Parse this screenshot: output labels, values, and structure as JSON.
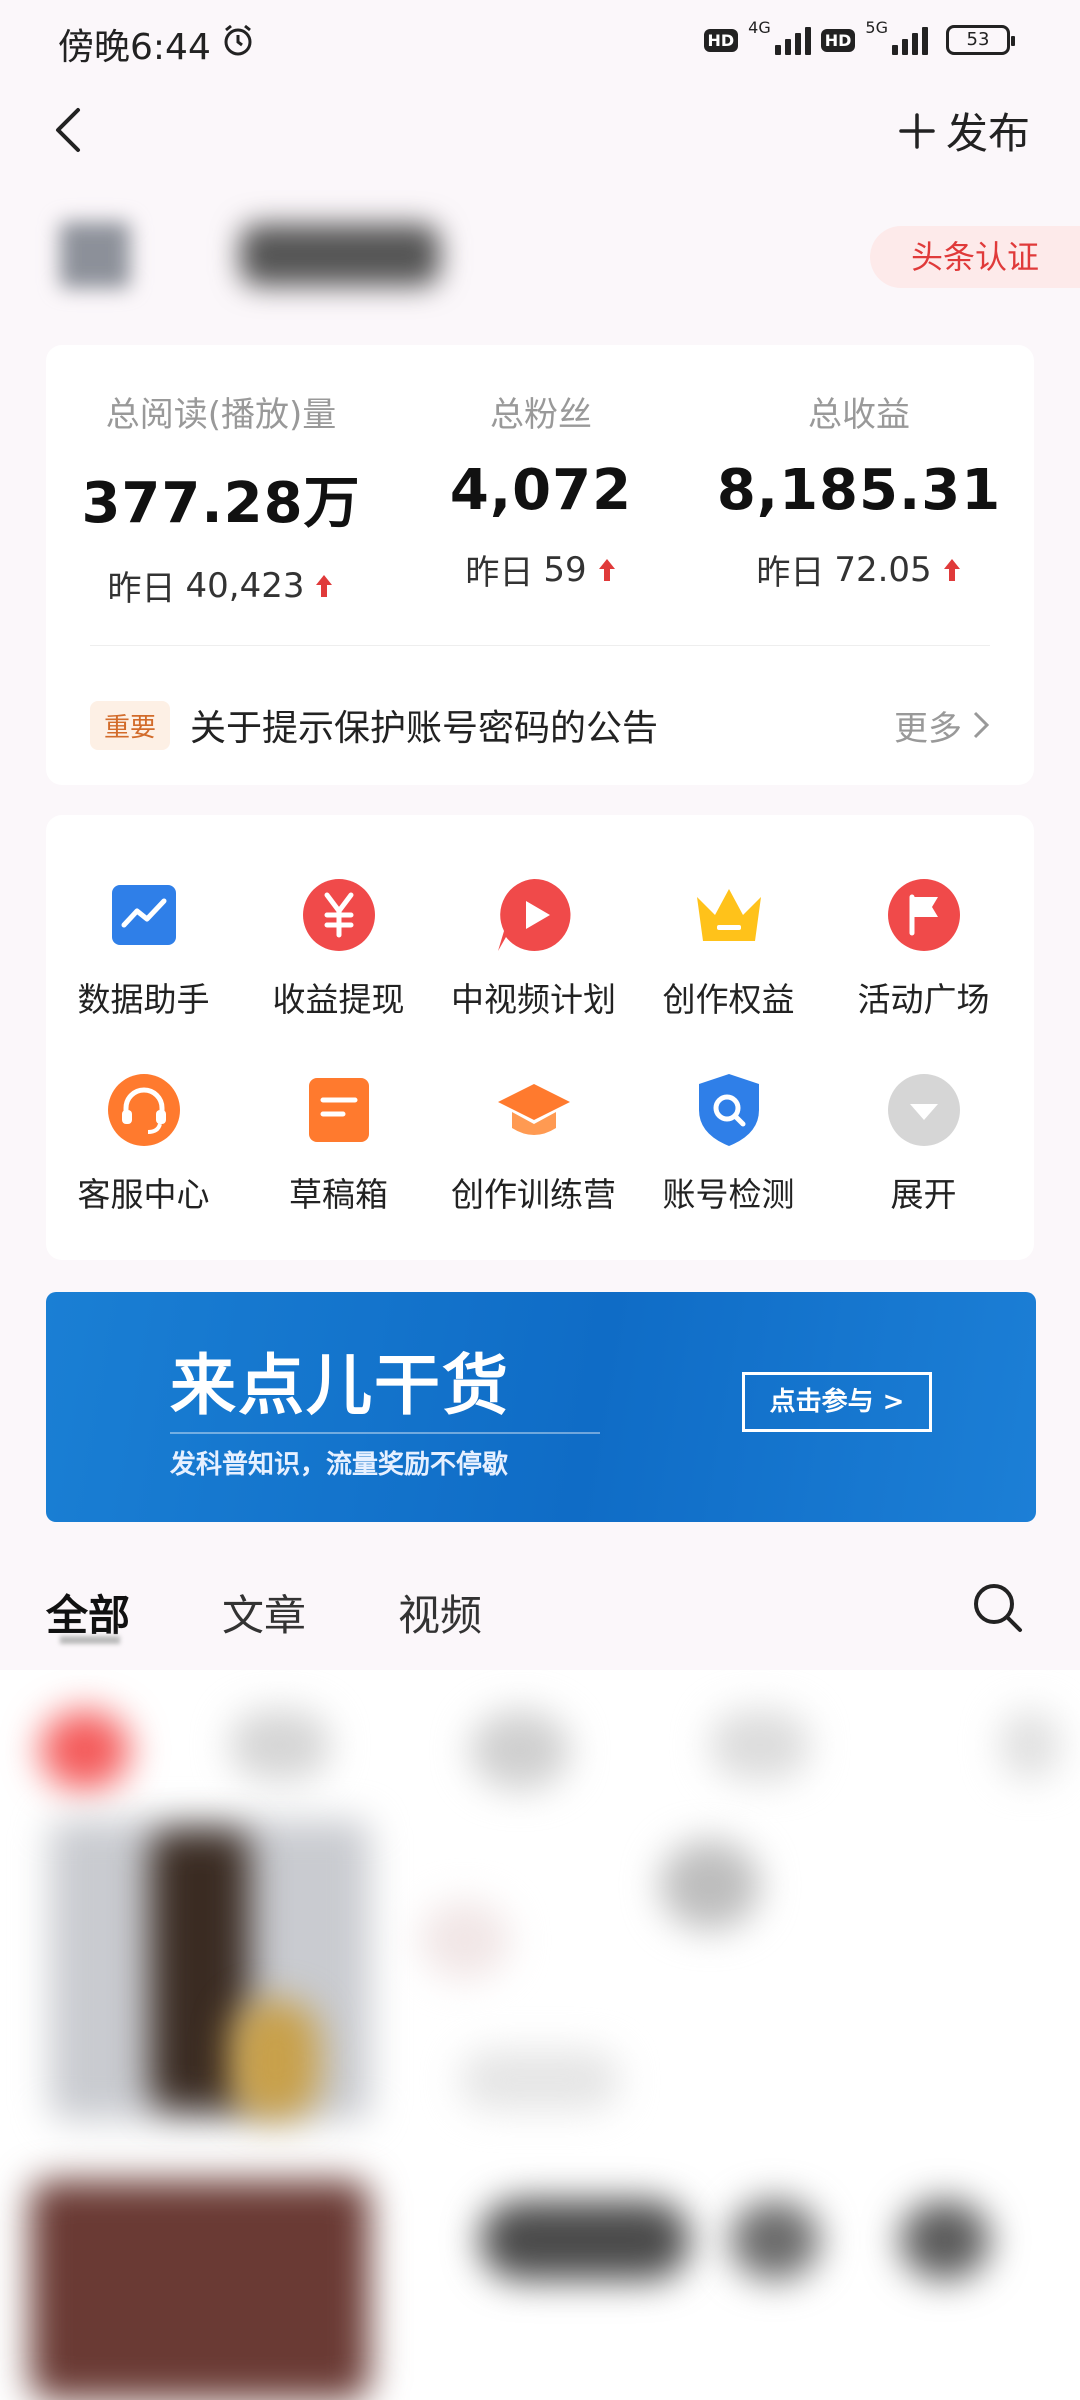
{
  "status_bar": {
    "time": "傍晚6:44",
    "hd1": "HD",
    "net1": "4G",
    "hd2": "HD",
    "net2": "5G",
    "battery": "53"
  },
  "header": {
    "back_icon": "chevron-left-icon",
    "publish_label": "发布"
  },
  "profile": {
    "certification": "头条认证"
  },
  "stats": [
    {
      "label": "总阅读(播放)量",
      "value": "377.28万",
      "yesterday_prefix": "昨日",
      "yesterday": "40,423"
    },
    {
      "label": "总粉丝",
      "value": "4,072",
      "yesterday_prefix": "昨日",
      "yesterday": "59"
    },
    {
      "label": "总收益",
      "value": "8,185.31",
      "yesterday_prefix": "昨日",
      "yesterday": "72.05"
    }
  ],
  "notice": {
    "tag": "重要",
    "text": "关于提示保护账号密码的公告",
    "more": "更多"
  },
  "tools": [
    {
      "label": "数据助手",
      "icon": "chart-icon",
      "color": "#2f7fe8"
    },
    {
      "label": "收益提现",
      "icon": "yuan-icon",
      "color": "#f04a4a"
    },
    {
      "label": "中视频计划",
      "icon": "video-play-icon",
      "color": "#f04a4a"
    },
    {
      "label": "创作权益",
      "icon": "crown-icon",
      "color": "#ffc21a"
    },
    {
      "label": "活动广场",
      "icon": "flag-icon",
      "color": "#f04a4a"
    },
    {
      "label": "客服中心",
      "icon": "headset-icon",
      "color": "#ff7a2e"
    },
    {
      "label": "草稿箱",
      "icon": "draft-icon",
      "color": "#ff7a2e"
    },
    {
      "label": "创作训练营",
      "icon": "graduation-cap-icon",
      "color": "#ff7a2e"
    },
    {
      "label": "账号检测",
      "icon": "shield-search-icon",
      "color": "#2f7fe8"
    },
    {
      "label": "展开",
      "icon": "expand-down-icon",
      "color": "#cccccc"
    }
  ],
  "banner": {
    "title": "来点儿干货",
    "subtitle": "发科普知识，流量奖励不停歇",
    "button": "点击参与 >"
  },
  "tabs": {
    "all": "全部",
    "articles": "文章",
    "videos": "视频"
  }
}
